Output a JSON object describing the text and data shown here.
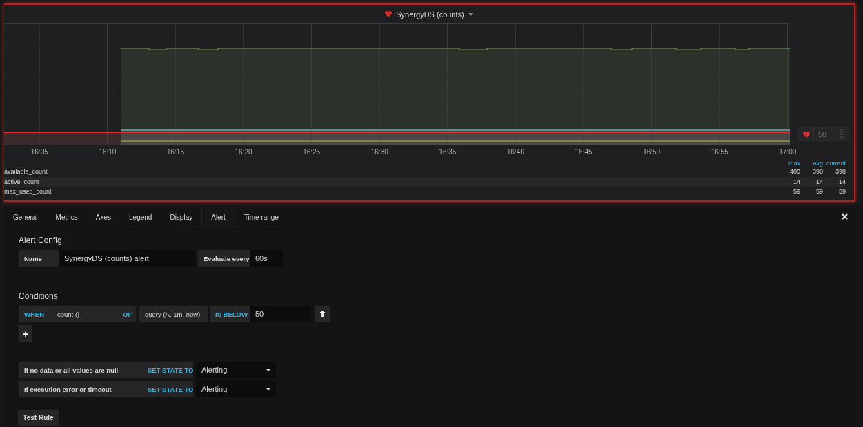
{
  "panel": {
    "title": "SynergyDS (counts)"
  },
  "graph": {
    "time_labels": [
      "16:05",
      "16:10",
      "16:15",
      "16:20",
      "16:25",
      "16:30",
      "16:35",
      "16:40",
      "16:45",
      "16:50",
      "16:55",
      "17:00"
    ],
    "threshold_handle": {
      "value": "50"
    }
  },
  "legend": {
    "columns": [
      "max",
      "avg",
      "current"
    ],
    "rows": [
      {
        "name": "available_count",
        "values": [
          "400",
          "398",
          "398"
        ]
      },
      {
        "name": "active_count",
        "values": [
          "14",
          "14",
          "14"
        ]
      },
      {
        "name": "max_used_count",
        "values": [
          "59",
          "59",
          "59"
        ]
      }
    ]
  },
  "editor": {
    "tabs": [
      {
        "label": "General",
        "selected": false
      },
      {
        "label": "Metrics",
        "selected": false
      },
      {
        "label": "Axes",
        "selected": false
      },
      {
        "label": "Legend",
        "selected": false
      },
      {
        "label": "Display",
        "selected": false
      },
      {
        "label": "Alert",
        "selected": true
      },
      {
        "label": "Time range",
        "selected": false
      }
    ],
    "alert_config": {
      "heading": "Alert Config",
      "name_label": "Name",
      "name_value": "SynergyDS (counts) alert",
      "evaluate_label": "Evaluate every",
      "evaluate_value": "60s"
    },
    "conditions": {
      "heading": "Conditions",
      "when": "WHEN",
      "reducer": "count ()",
      "of": "OF",
      "query": "query (A, 1m, now)",
      "evaluator": "IS BELOW",
      "threshold": "50",
      "add": "+"
    },
    "state_rules": [
      {
        "label": "If no data or all values are null",
        "action": "SET STATE TO",
        "value": "Alerting"
      },
      {
        "label": "If execution error or timeout",
        "action": "SET STATE TO",
        "value": "Alerting"
      }
    ],
    "test_button": "Test Rule"
  }
}
